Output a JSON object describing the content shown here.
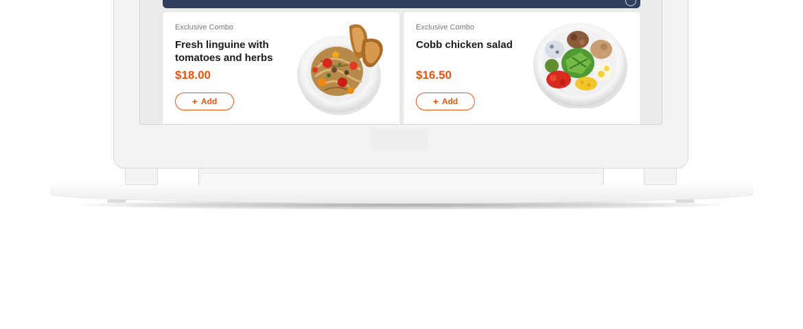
{
  "products": [
    {
      "tag": "Exclusive Combo",
      "title": "Fresh linguine with tomatoes and herbs",
      "price": "$18.00",
      "add_label": "Add",
      "image": "linguine-pasta-dish"
    },
    {
      "tag": "Exclusive Combo",
      "title": "Cobb chicken salad",
      "price": "$16.50",
      "add_label": "Add",
      "image": "cobb-chicken-salad-dish"
    }
  ],
  "icons": {
    "add": "plus-icon",
    "top_right": "circle-icon"
  },
  "colors": {
    "accent": "#e8540e",
    "header": "#2f3e5c",
    "title": "#1a1a1a",
    "tag": "#7a7a7a"
  }
}
